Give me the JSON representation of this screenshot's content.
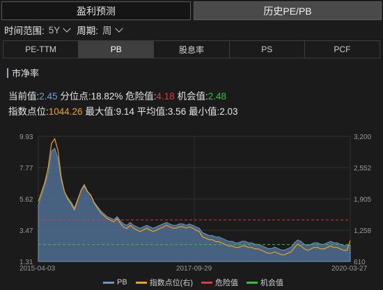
{
  "top_tabs": [
    {
      "label": "盈利预测",
      "active": false
    },
    {
      "label": "历史PE/PB",
      "active": true
    }
  ],
  "filters": {
    "range_label": "时间范围:",
    "range_value": "5Y",
    "period_label": "周期:",
    "period_value": "周"
  },
  "sub_tabs": [
    {
      "label": "PE-TTM",
      "active": false
    },
    {
      "label": "PB",
      "active": true
    },
    {
      "label": "股息率",
      "active": false
    },
    {
      "label": "PS",
      "active": false
    },
    {
      "label": "PCF",
      "active": false
    }
  ],
  "section_title": "市净率",
  "stats": {
    "current_label": "当前值:",
    "current_value": "2.45",
    "percentile_label": "分位点:",
    "percentile_value": "18.82%",
    "danger_label": "危险值:",
    "danger_value": "4.18",
    "opportunity_label": "机会值:",
    "opportunity_value": "2.48",
    "index_label": "指数点位:",
    "index_value": "1044.26",
    "max_label": "最大值:",
    "max_value": "9.14",
    "avg_label": "平均值:",
    "avg_value": "3.56",
    "min_label": "最小值:",
    "min_value": "2.03"
  },
  "colors": {
    "pb_fill": "#4d6e92",
    "pb_line": "#6f97c2",
    "index_line": "#f0a11d",
    "danger": "#e03a3a",
    "opportunity": "#34c23a"
  },
  "chart_data": {
    "type": "area",
    "y_left_ticks": [
      "9.93",
      "7.77",
      "5.62",
      "3.47",
      "1.31"
    ],
    "y_right_ticks": [
      "3,200",
      "2,552",
      "1,905",
      "1,258",
      "610"
    ],
    "ylim_left": [
      1.31,
      9.93
    ],
    "ylim_right": [
      610,
      3200
    ],
    "x_tick_labels": [
      "2015-04-03",
      "2017-09-29",
      "2020-03-27"
    ],
    "grid": true,
    "legend_position": "bottom",
    "danger_value": 4.18,
    "opportunity_value": 2.48,
    "series": [
      {
        "name": "PB",
        "values": [
          5.2,
          5.9,
          6.6,
          7.4,
          8.9,
          9.1,
          8.4,
          6.9,
          6.1,
          5.7,
          5.4,
          5.0,
          5.6,
          6.2,
          6.5,
          6.1,
          5.9,
          5.4,
          5.1,
          4.8,
          4.6,
          4.4,
          4.3,
          4.2,
          4.4,
          4.1,
          3.9,
          3.8,
          4.0,
          3.8,
          3.7,
          3.6,
          3.7,
          3.8,
          3.7,
          3.6,
          3.7,
          3.8,
          3.9,
          4.0,
          3.9,
          3.8,
          3.8,
          3.9,
          3.9,
          3.8,
          3.9,
          3.8,
          3.7,
          3.6,
          3.3,
          3.2,
          3.1,
          3.1,
          3.0,
          3.0,
          2.9,
          2.8,
          2.7,
          2.7,
          2.6,
          2.6,
          2.7,
          2.7,
          2.6,
          2.6,
          2.5,
          2.5,
          2.4,
          2.3,
          2.2,
          2.2,
          2.3,
          2.2,
          2.1,
          2.1,
          2.2,
          2.3,
          2.6,
          2.8,
          2.7,
          2.5,
          2.4,
          2.5,
          2.6,
          2.6,
          2.5,
          2.5,
          2.6,
          2.7,
          2.6,
          2.6,
          2.5,
          2.4,
          2.4,
          2.45
        ]
      },
      {
        "name": "指数点位(右)",
        "values": [
          1850,
          2050,
          2250,
          2550,
          3050,
          3150,
          2900,
          2350,
          2050,
          1900,
          1800,
          1680,
          1880,
          2080,
          2200,
          2060,
          1980,
          1820,
          1720,
          1620,
          1560,
          1500,
          1460,
          1430,
          1500,
          1400,
          1320,
          1290,
          1360,
          1300,
          1260,
          1230,
          1260,
          1300,
          1260,
          1230,
          1260,
          1290,
          1320,
          1360,
          1330,
          1300,
          1300,
          1330,
          1330,
          1300,
          1330,
          1300,
          1260,
          1230,
          1120,
          1090,
          1060,
          1060,
          1020,
          1020,
          990,
          960,
          930,
          930,
          900,
          900,
          930,
          930,
          900,
          900,
          870,
          870,
          840,
          810,
          780,
          780,
          810,
          780,
          750,
          750,
          780,
          810,
          900,
          970,
          930,
          870,
          840,
          870,
          900,
          900,
          870,
          870,
          900,
          930,
          900,
          900,
          870,
          840,
          840,
          1044
        ]
      }
    ]
  },
  "legend": [
    {
      "label": "PB",
      "color": "#6f97c2"
    },
    {
      "label": "指数点位(右)",
      "color": "#f0a11d"
    },
    {
      "label": "危险值",
      "color": "#e03a3a"
    },
    {
      "label": "机会值",
      "color": "#34c23a"
    }
  ]
}
